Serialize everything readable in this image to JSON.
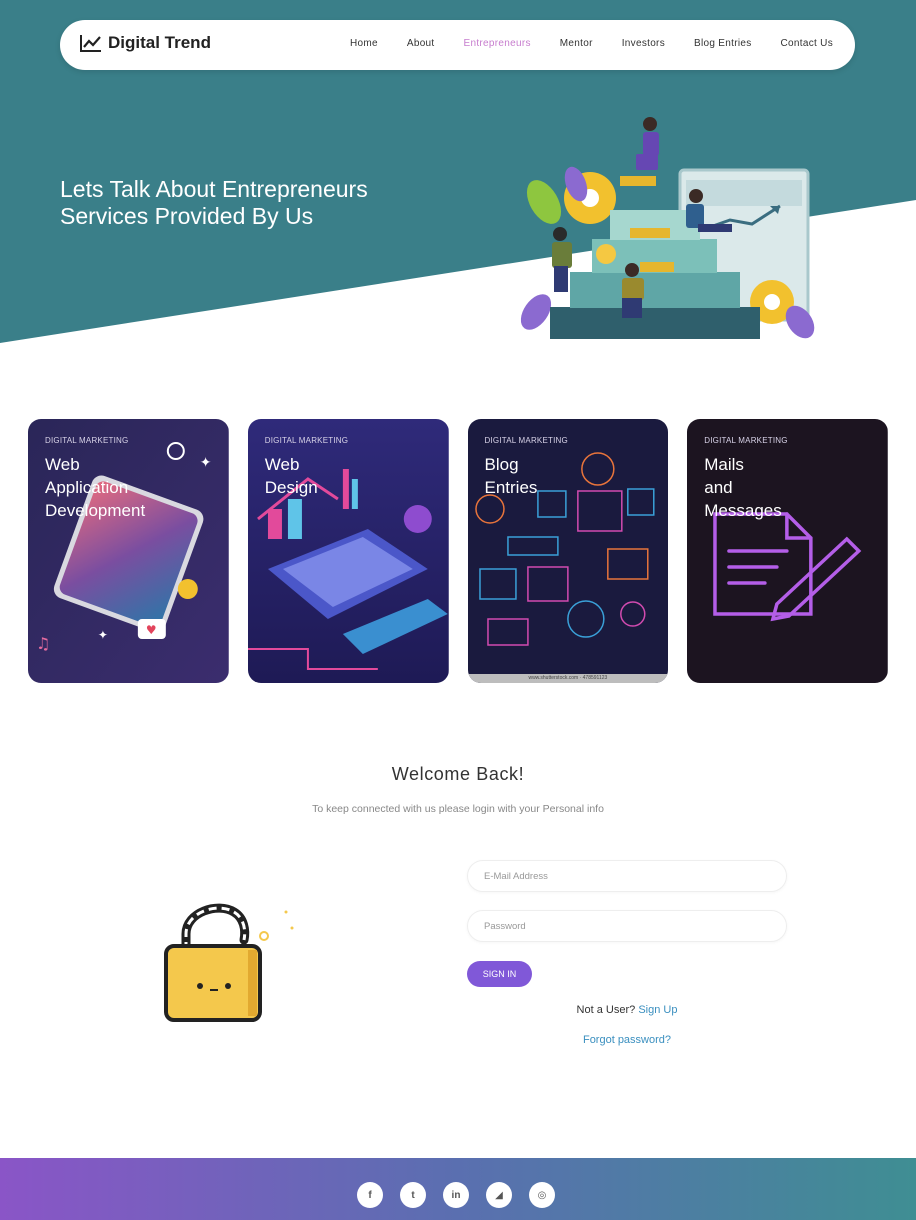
{
  "header": {
    "brand": "Digital Trend",
    "nav": [
      {
        "label": "Home",
        "active": false
      },
      {
        "label": "About",
        "active": false
      },
      {
        "label": "Entrepreneurs",
        "active": true
      },
      {
        "label": "Mentor",
        "active": false
      },
      {
        "label": "Investors",
        "active": false
      },
      {
        "label": "Blog Entries",
        "active": false
      },
      {
        "label": "Contact Us",
        "active": false
      }
    ]
  },
  "hero": {
    "title_line1": "Lets Talk About Entrepreneurs",
    "title_line2": "Services Provided By Us"
  },
  "cards": [
    {
      "kicker": "DIGITAL MARKETING",
      "title_lines": [
        "Web",
        "Application",
        "Development"
      ]
    },
    {
      "kicker": "DIGITAL MARKETING",
      "title_lines": [
        "Web",
        "Design"
      ]
    },
    {
      "kicker": "DIGITAL MARKETING",
      "title_lines": [
        "Blog",
        "Entries"
      ],
      "credit": "www.shutterstock.com · 478591123"
    },
    {
      "kicker": "DIGITAL MARKETING",
      "title_lines": [
        "Mails",
        "and",
        "Messages"
      ]
    }
  ],
  "login": {
    "heading": "Welcome Back!",
    "subtitle": "To keep connected with us please login with your Personal info",
    "email_placeholder": "E-Mail Address",
    "password_placeholder": "Password",
    "signin_label": "SIGN IN",
    "not_user": "Not a User?",
    "signup_label": "Sign Up",
    "forgot_label": "Forgot password?"
  },
  "footer": {
    "socials": [
      {
        "icon": "facebook-icon",
        "glyph": "f",
        "color": "#555555"
      },
      {
        "icon": "twitter-icon",
        "glyph": "t",
        "color": "#555555"
      },
      {
        "icon": "linkedin-icon",
        "glyph": "in",
        "color": "#555555"
      },
      {
        "icon": "rss-icon",
        "glyph": "◢",
        "color": "#555555"
      },
      {
        "icon": "dribbble-icon",
        "glyph": "◎",
        "color": "#555555"
      }
    ]
  },
  "colors": {
    "hero_teal": "#3a7f89",
    "accent_purple": "#8058d8",
    "active_nav": "#c77dce",
    "link_blue": "#3a8fbf"
  }
}
